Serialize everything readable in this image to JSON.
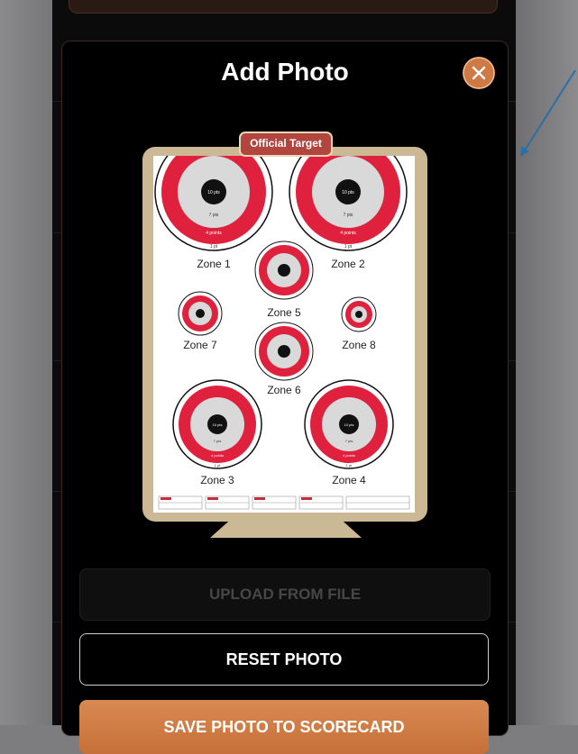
{
  "modal": {
    "title": "Add Photo",
    "close_icon": "close-icon",
    "badge": "Official Target"
  },
  "target": {
    "zones": [
      {
        "label": "Zone 1",
        "ring_labels": [
          "10 pts",
          "7 pts",
          "4 points",
          "1 pt"
        ]
      },
      {
        "label": "Zone 2",
        "ring_labels": [
          "10 pts",
          "7 pts",
          "4 points",
          "1 pt"
        ]
      },
      {
        "label": "Zone 5",
        "ring_labels": []
      },
      {
        "label": "Zone 7",
        "ring_labels": []
      },
      {
        "label": "Zone 8",
        "ring_labels": []
      },
      {
        "label": "Zone 6",
        "ring_labels": []
      },
      {
        "label": "Zone 3",
        "ring_labels": [
          "10 pts",
          "7 pts",
          "4 points",
          "1 pt"
        ]
      },
      {
        "label": "Zone 4",
        "ring_labels": [
          "10 pts",
          "7 pts",
          "4 points",
          "1 pt"
        ]
      }
    ]
  },
  "buttons": {
    "upload": "UPLOAD FROM FILE",
    "reset": "RESET PHOTO",
    "save": "SAVE PHOTO TO SCORECARD"
  },
  "colors": {
    "accent": "#cf7a45",
    "target_red": "#e0213e",
    "badge": "#b2453d",
    "clipboard": "#cbb894"
  }
}
